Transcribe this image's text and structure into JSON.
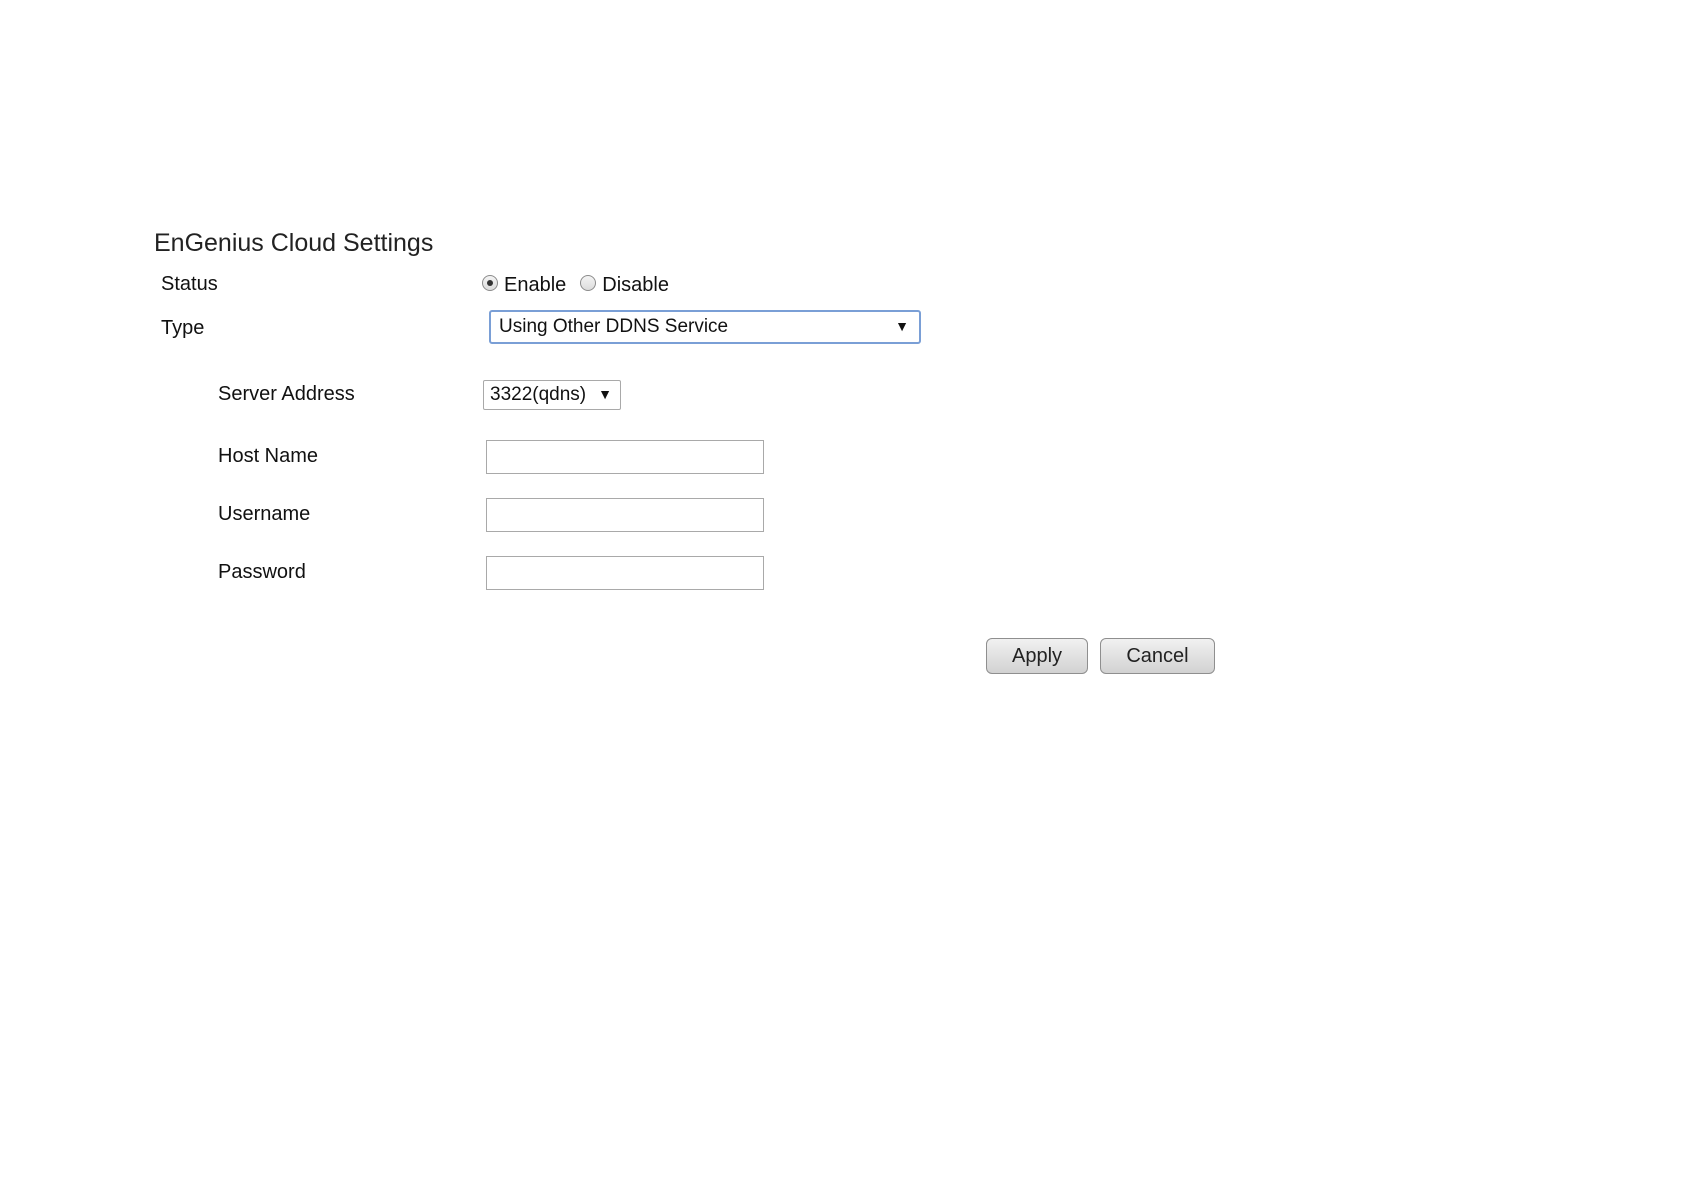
{
  "page": {
    "title": "EnGenius Cloud Settings"
  },
  "form": {
    "status": {
      "label": "Status",
      "options": [
        "Enable",
        "Disable"
      ],
      "selected": "Enable"
    },
    "type": {
      "label": "Type",
      "value": "Using Other DDNS Service"
    },
    "server_address": {
      "label": "Server Address",
      "value": "3322(qdns)"
    },
    "host_name": {
      "label": "Host Name",
      "value": ""
    },
    "username": {
      "label": "Username",
      "value": ""
    },
    "password": {
      "label": "Password",
      "value": ""
    }
  },
  "actions": {
    "apply_label": "Apply",
    "cancel_label": "Cancel"
  },
  "icons": {
    "dropdown_arrow": "chevron-down-icon"
  },
  "colors": {
    "focus_border": "#7a9fd6",
    "button_border": "#8f8f8f",
    "input_border": "#a9a9a9"
  }
}
